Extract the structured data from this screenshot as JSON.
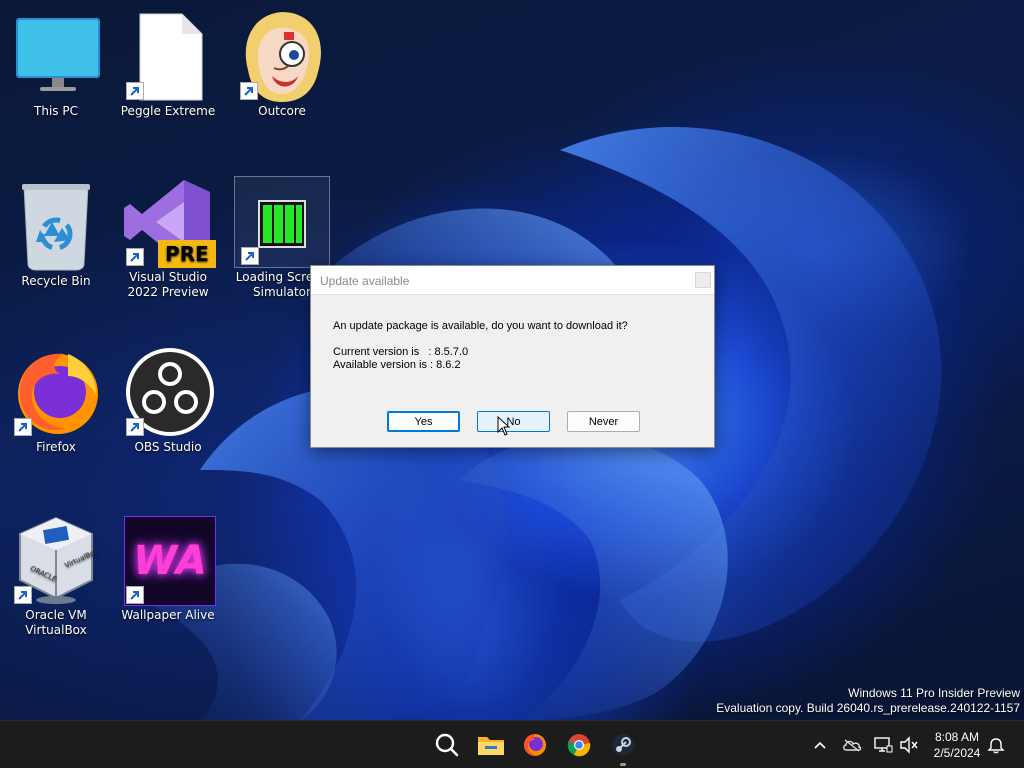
{
  "desktop": {
    "icons": [
      {
        "label": "This PC"
      },
      {
        "label": "Peggle Extreme"
      },
      {
        "label": "Outcore"
      },
      {
        "label": "Recycle Bin"
      },
      {
        "label": "Visual Studio 2022 Preview",
        "badge": "PRE"
      },
      {
        "label": "Loading Screen Simulator"
      },
      {
        "label": "Firefox"
      },
      {
        "label": "OBS Studio"
      },
      {
        "label": "Oracle VM VirtualBox",
        "box_label": "VirtualBox"
      },
      {
        "label": "Wallpaper Alive",
        "logo_text": "WA"
      }
    ]
  },
  "dialog": {
    "title": "Update available",
    "message": "An update package is available, do you want to download it?",
    "current_version_line": "Current version is   : 8.5.7.0",
    "available_version_line": "Available version is : 8.6.2",
    "buttons": {
      "yes": "Yes",
      "no": "No",
      "never": "Never"
    }
  },
  "watermark": {
    "line1": "Windows 11 Pro Insider Preview",
    "line2": "Evaluation copy. Build 26040.rs_prerelease.240122-1157"
  },
  "taskbar": {
    "apps": [
      "search-icon",
      "file-explorer-icon",
      "firefox-icon",
      "chrome-icon",
      "steam-icon"
    ],
    "tray": [
      "chevron-up-icon",
      "onedrive-icon",
      "network-icon",
      "volume-muted-icon",
      "notification-bell-icon"
    ],
    "clock": {
      "time": "8:08 AM",
      "date": "2/5/2024"
    }
  },
  "colors": {
    "accent": "#0078d7",
    "taskbar": "#1c1c1c",
    "dialog_bg": "#f0f0f0"
  }
}
